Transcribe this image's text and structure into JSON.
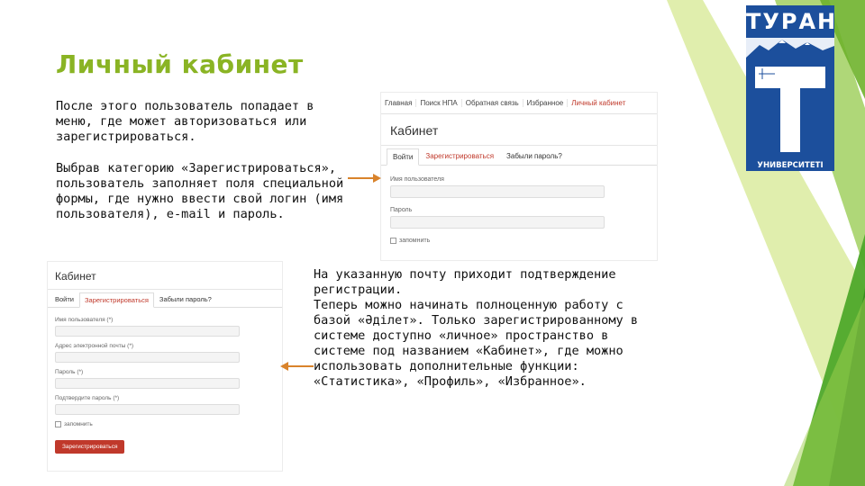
{
  "title": "Личный кабинет",
  "paragraph1": "После этого пользователь попадает в меню, где может авторизоваться или зарегистрироваться.",
  "paragraph2": "Выбрав категорию «Зарегистрироваться», пользователь заполняет поля специальной формы, где нужно ввести свой логин (имя пользователя), e-mail и пароль.",
  "paragraph3": {
    "line1": "На указанную почту приходит подтверждение регистрации.",
    "line2": "Теперь можно начинать полноценную работу с базой «Әділет». Только зарегистрированному в системе доступно «личное» пространство в системе под названием «Кабинет», где можно использовать дополнительные функции: «Статистика», «Профиль», «Избранное»."
  },
  "logo": {
    "top_text": "ТУРАН",
    "bottom_text": "УНИВЕРСИТЕТІ",
    "brand_color": "#1c4f9c"
  },
  "shot1": {
    "nav": [
      "Главная",
      "Поиск НПА",
      "Обратная связь",
      "Избранное",
      "Личный кабинет"
    ],
    "heading": "Кабинет",
    "tabs": [
      "Войти",
      "Зарегистрироваться",
      "Забыли пароль?"
    ],
    "fields": [
      "Имя пользователя",
      "Пароль"
    ],
    "remember": "запомнить"
  },
  "shot2": {
    "heading": "Кабинет",
    "tabs": [
      "Войти",
      "Зарегистрироваться",
      "Забыли пароль?"
    ],
    "fields": [
      "Имя пользователя (*)",
      "Адрес электронной почты (*)",
      "Пароль (*)",
      "Подтвердите пароль (*)"
    ],
    "remember": "запомнить",
    "register_button": "Зарегистрироваться"
  },
  "colors": {
    "accent_green": "#8ab424",
    "link_red": "#c0392b",
    "arrow_orange": "#d9832b"
  }
}
